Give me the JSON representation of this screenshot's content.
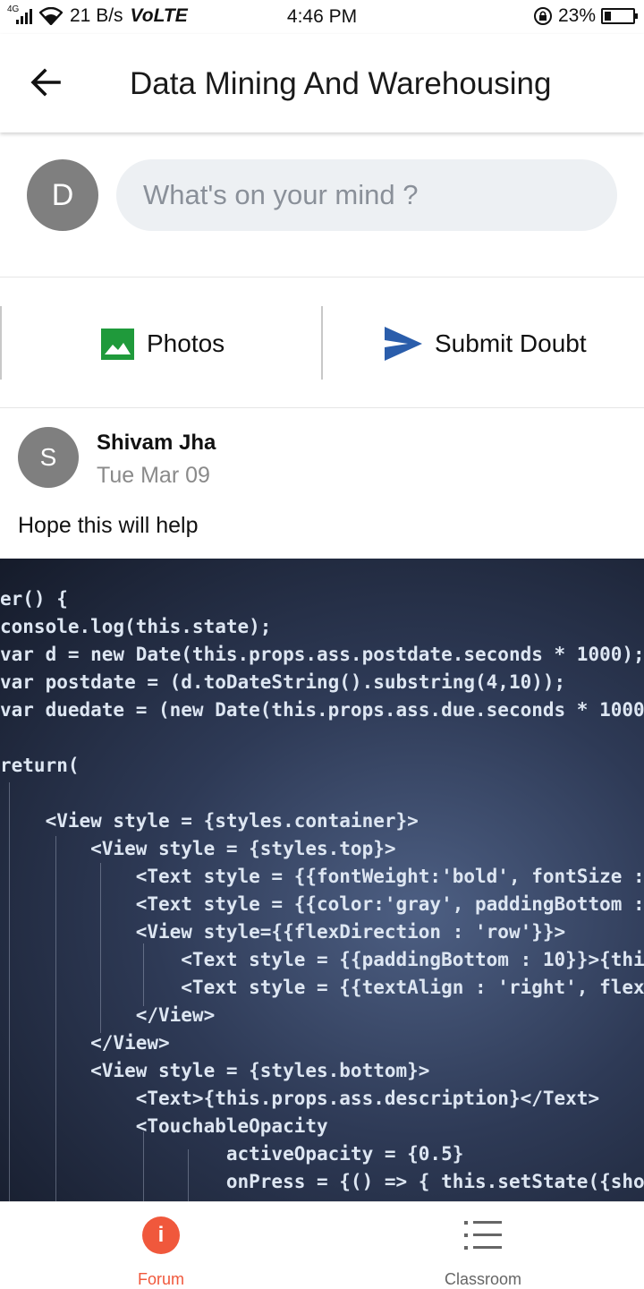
{
  "status_bar": {
    "network": "4G",
    "speed": "21 B/s",
    "volte": "VoLTE",
    "time": "4:46 PM",
    "battery": "23%",
    "battery_level": 0.23
  },
  "header": {
    "title": "Data Mining And Warehousing"
  },
  "composer": {
    "avatar_initial": "D",
    "placeholder": "What's on your mind ?"
  },
  "actions": {
    "photos_label": "Photos",
    "submit_label": "Submit Doubt",
    "photo_icon_color": "#1f9a3b",
    "send_icon_color": "#2a5dab"
  },
  "post": {
    "avatar_initial": "S",
    "author": "Shivam Jha",
    "date": "Tue Mar 09",
    "text": "Hope this will help",
    "image_code": [
      "er() {",
      "console.log(this.state);",
      "var d = new Date(this.props.ass.postdate.seconds * 1000);",
      "var postdate = (d.toDateString().substring(4,10));",
      "var duedate = (new Date(this.props.ass.due.seconds * 1000",
      "",
      "return(",
      "",
      "    <View style = {styles.container}>",
      "        <View style = {styles.top}>",
      "            <Text style = {{fontWeight:'bold', fontSize :",
      "            <Text style = {{color:'gray', paddingBottom :",
      "            <View style={{flexDirection : 'row'}}>",
      "                <Text style = {{paddingBottom : 10}}>{thi",
      "                <Text style = {{textAlign : 'right', flex",
      "            </View>",
      "        </View>",
      "        <View style = {styles.bottom}>",
      "            <Text>{this.props.ass.description}</Text>",
      "            <TouchableOpacity",
      "                    activeOpacity = {0.5}",
      "                    onPress = {() => { this.setState({sho"
    ]
  },
  "bottom_nav": {
    "forum_label": "Forum",
    "forum_icon_glyph": "i",
    "classroom_label": "Classroom",
    "active_color": "#f0583c"
  }
}
